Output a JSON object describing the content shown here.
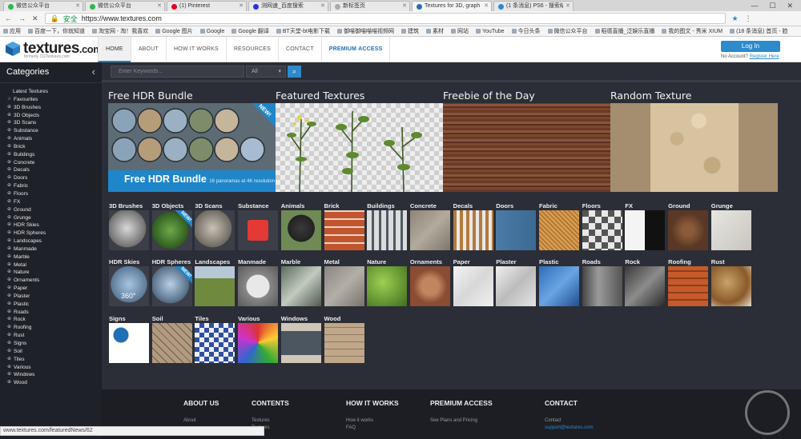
{
  "browser": {
    "tabs": [
      {
        "label": "微信公众平台",
        "color": "#2db84d"
      },
      {
        "label": "微信公众平台",
        "color": "#2db84d"
      },
      {
        "label": "(1) Pinterest",
        "color": "#e60023"
      },
      {
        "label": "测网速_百度搜索",
        "color": "#2932e1"
      },
      {
        "label": "新标签页",
        "color": "#aaaaaa"
      },
      {
        "label": "Textures for 3D, graph",
        "color": "#2d6cb5"
      },
      {
        "label": "(1 条消息) PS6 - 搜索结",
        "color": "#2d8acb"
      }
    ],
    "url_secure": "安全",
    "url": "https://www.textures.com",
    "bookmarks": [
      "应用",
      "百度一下，你就知道",
      "淘宝网 - 淘！我喜欢",
      "Google 图片",
      "Google",
      "Google 翻译",
      "BT天堂-bt电影下载",
      "御喵御喵喵喵视频网",
      "建筑",
      "素材",
      "网站",
      "YouTube",
      "今日头条",
      "微信公众平台",
      "稻德直播_泛娱乐直播",
      "我的图文 - 秀米 XIUM",
      "(18 条消息) 首页 - 脸"
    ],
    "status_text": "www.textures.com/featuredNews/62"
  },
  "header": {
    "logo_name": "textures",
    "logo_tld": ".com",
    "logo_sub": "formerly CGTextures.com",
    "nav": [
      "HOME",
      "ABOUT",
      "HOW IT WORKS",
      "RESOURCES",
      "CONTACT",
      "PREMIUM ACCESS"
    ],
    "login": "Log In",
    "no_account": "No Account?",
    "register": "Register Here"
  },
  "sidebar": {
    "title": "Categories",
    "items": [
      "Latest Textures",
      "Favourites",
      "3D Brushes",
      "3D Objects",
      "3D Scans",
      "Substance",
      "Animals",
      "Brick",
      "Buildings",
      "Concrete",
      "Decals",
      "Doors",
      "Fabric",
      "Floors",
      "FX",
      "Ground",
      "Grunge",
      "HDR Skies",
      "HDR Spheres",
      "Landscapes",
      "Manmade",
      "Marble",
      "Metal",
      "Nature",
      "Ornaments",
      "Paper",
      "Plaster",
      "Plastic",
      "Roads",
      "Rock",
      "Roofing",
      "Rust",
      "Signs",
      "Soil",
      "Tiles",
      "Various",
      "Windows",
      "Wood"
    ]
  },
  "search": {
    "placeholder": "Enter Keywords...",
    "scope": "All"
  },
  "features": [
    {
      "title": "Free HDR Bundle",
      "banner": "Free HDR Bundle",
      "banner_sub": "16 panoramas at 4K resolution",
      "badge": "NEW!"
    },
    {
      "title": "Featured Textures"
    },
    {
      "title": "Freebie of the Day"
    },
    {
      "title": "Random Texture"
    }
  ],
  "grid": {
    "row1": [
      "3D Brushes",
      "3D Objects",
      "3D Scans",
      "Substance",
      "Animals",
      "Brick",
      "Buildings",
      "Concrete",
      "Decals",
      "Doors",
      "Fabric",
      "Floors",
      "FX",
      "Ground",
      "Grunge"
    ],
    "row2": [
      "HDR Skies",
      "HDR Spheres",
      "Landscapes",
      "Manmade",
      "Marble",
      "Metal",
      "Nature",
      "Ornaments",
      "Paper",
      "Plaster",
      "Plastic",
      "Roads",
      "Rock",
      "Roofing",
      "Rust"
    ],
    "row3": [
      "Signs",
      "Soil",
      "Tiles",
      "Various",
      "Windows",
      "Wood"
    ],
    "badge_new": "NEW!",
    "hdr_label": "360°"
  },
  "footer": {
    "about": {
      "title": "ABOUT US",
      "link": "About"
    },
    "contents": {
      "title": "CONTENTS",
      "link": "Textures",
      "link2": "Textures"
    },
    "how": {
      "title": "HOW IT WORKS",
      "link": "How it works",
      "link2": "FAQ"
    },
    "premium": {
      "title": "PREMIUM ACCESS",
      "link": "See Plans and Pricing"
    },
    "contact": {
      "title": "CONTACT",
      "link": "Contact",
      "link2": "support@textures.com"
    }
  },
  "colors": {
    "accent": "#2d8acb",
    "bg": "#2b2e36",
    "sidebar": "#1f2128"
  }
}
